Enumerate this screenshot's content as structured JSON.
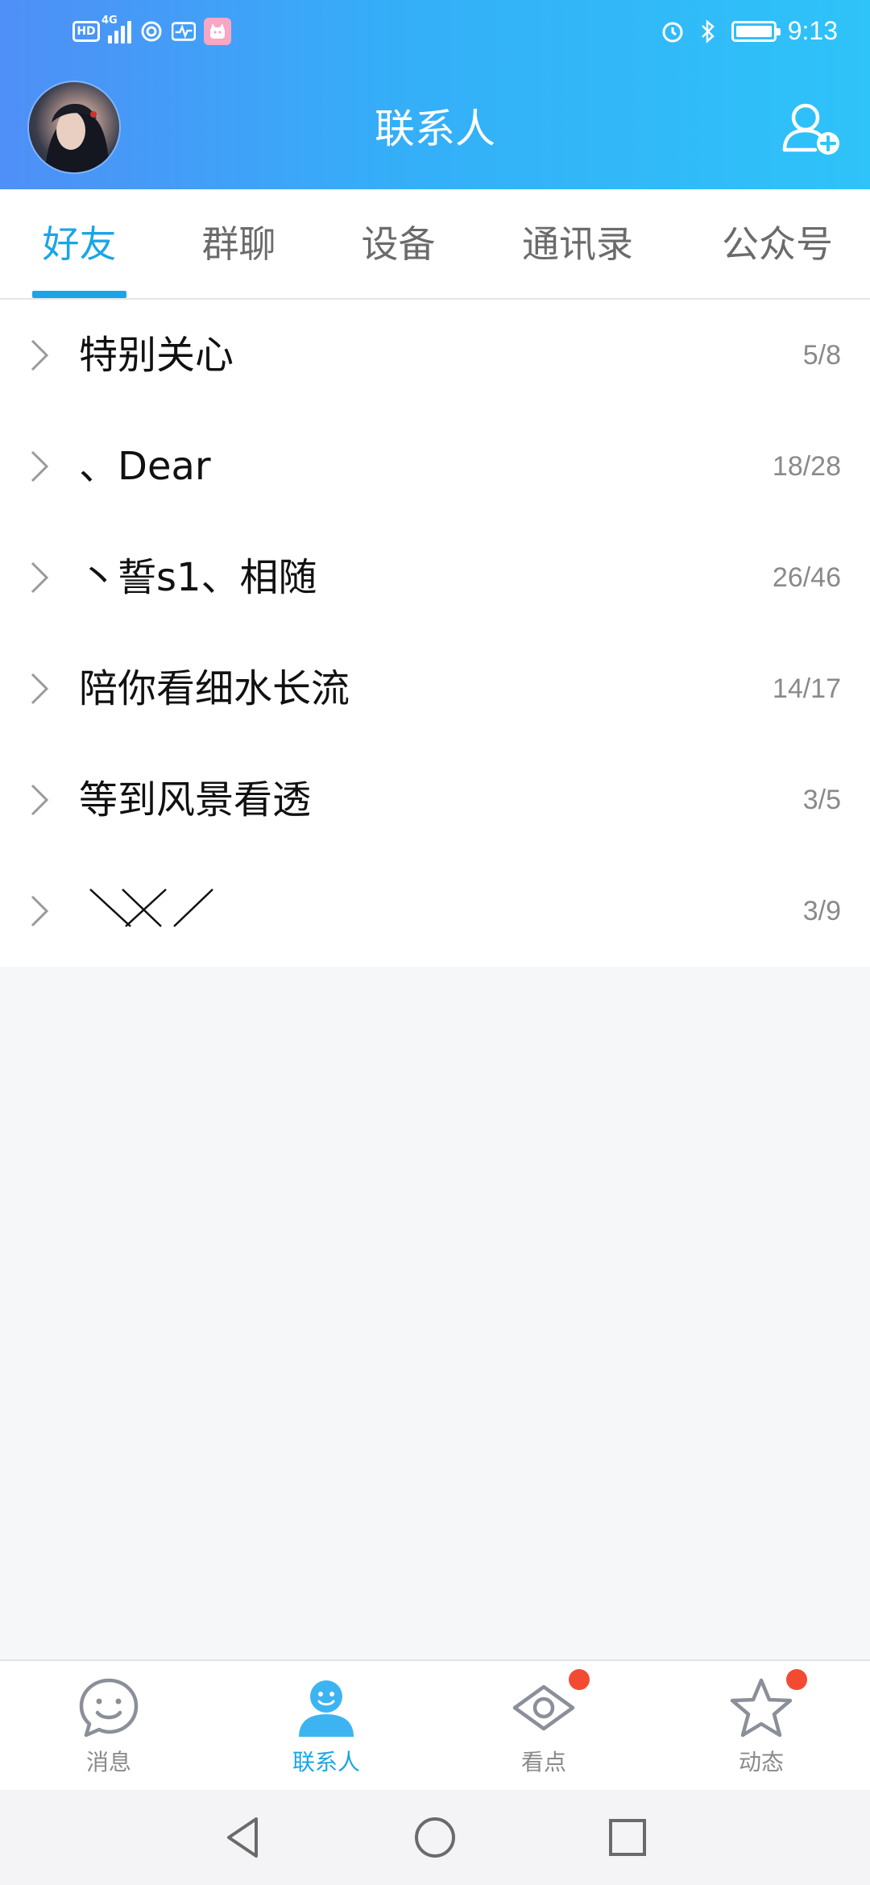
{
  "status_bar": {
    "hd_badge": "HD",
    "network_type": "4G",
    "time": "9:13",
    "icons": [
      "hd-icon",
      "signal-icon",
      "hotspot-icon",
      "health-icon",
      "app-icon",
      "alarm-icon",
      "bluetooth-icon",
      "battery-icon"
    ]
  },
  "header": {
    "title": "联系人",
    "add_contact_icon": "add-contact-icon",
    "avatar": "user-avatar"
  },
  "tabs": [
    {
      "label": "好友",
      "active": true
    },
    {
      "label": "群聊",
      "active": false
    },
    {
      "label": "设备",
      "active": false
    },
    {
      "label": "通讯录",
      "active": false
    },
    {
      "label": "公众号",
      "active": false
    }
  ],
  "groups": [
    {
      "name": "特别关心",
      "count": "5/8"
    },
    {
      "name": "、Dear",
      "count": "18/28"
    },
    {
      "name": "丶誓s1、相随",
      "count": "26/46"
    },
    {
      "name": "陪你看细水长流",
      "count": "14/17"
    },
    {
      "name": "等到风景看透",
      "count": "3/5"
    },
    {
      "name": "",
      "count": "3/9"
    }
  ],
  "bottom_nav": [
    {
      "label": "消息",
      "icon": "message-icon",
      "active": false,
      "badge": false
    },
    {
      "label": "联系人",
      "icon": "contacts-icon",
      "active": true,
      "badge": false
    },
    {
      "label": "看点",
      "icon": "eye-icon",
      "active": false,
      "badge": true
    },
    {
      "label": "动态",
      "icon": "star-icon",
      "active": false,
      "badge": true
    }
  ],
  "system_nav": [
    "back-icon",
    "home-icon",
    "recents-icon"
  ],
  "colors": {
    "header_gradient_start": "#4f8ff7",
    "header_gradient_end": "#2ec3f9",
    "accent": "#1ba5e6",
    "badge_red": "#f24b32",
    "page_background": "#f6f7f9"
  }
}
